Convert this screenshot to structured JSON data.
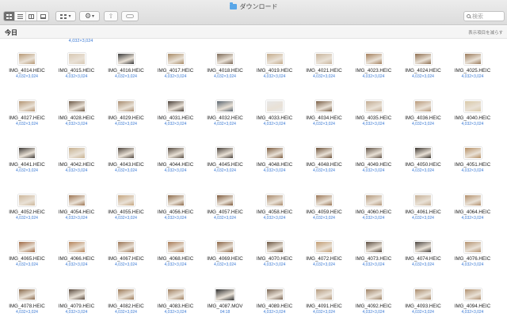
{
  "window": {
    "title": "ダウンロード"
  },
  "toolbar": {
    "search_placeholder": "検索"
  },
  "section": {
    "title": "今日",
    "show_less": "表示項目を減らす"
  },
  "top_partial_meta": "4,032×3,024",
  "rows": [
    [
      {
        "name": "IMG_4014.HEIC",
        "meta": "4,032×3,024",
        "tone": "#b89a76"
      },
      {
        "name": "IMG_4015.HEIC",
        "meta": "4,032×3,024",
        "tone": "#d8c9b4"
      },
      {
        "name": "IMG_4016.HEIC",
        "meta": "4,032×3,024",
        "tone": "#3a3a3a"
      },
      {
        "name": "IMG_4017.HEIC",
        "meta": "4,032×3,024",
        "tone": "#a88a66"
      },
      {
        "name": "IMG_4018.HEIC",
        "meta": "4,032×3,024",
        "tone": "#7d6a58"
      },
      {
        "name": "IMG_4019.HEIC",
        "meta": "4,032×3,024",
        "tone": "#c4ab8c"
      },
      {
        "name": "IMG_4021.HEIC",
        "meta": "4,032×3,024",
        "tone": "#c9b59d"
      },
      {
        "name": "IMG_4023.HEIC",
        "meta": "4,032×3,024",
        "tone": "#a47f5c"
      },
      {
        "name": "IMG_4024.HEIC",
        "meta": "4,032×3,024",
        "tone": "#8e6e4f"
      },
      {
        "name": "IMG_4025.HEIC",
        "meta": "4,032×3,024",
        "tone": "#9a7a5a"
      }
    ],
    [
      {
        "name": "IMG_4027.HEIC",
        "meta": "4,032×3,024",
        "tone": "#b49574"
      },
      {
        "name": "IMG_4028.HEIC",
        "meta": "4,032×3,024",
        "tone": "#6e5a48"
      },
      {
        "name": "IMG_4029.HEIC",
        "meta": "4,032×3,024",
        "tone": "#a88c70"
      },
      {
        "name": "IMG_4031.HEIC",
        "meta": "4,032×3,024",
        "tone": "#4a4038"
      },
      {
        "name": "IMG_4032.HEIC",
        "meta": "4,032×3,024",
        "tone": "#5b6670"
      },
      {
        "name": "IMG_4033.HEIC",
        "meta": "4,032×3,024",
        "tone": "#e6e6e6"
      },
      {
        "name": "IMG_4034.HEIC",
        "meta": "4,032×3,024",
        "tone": "#7a6048"
      },
      {
        "name": "IMG_4035.HEIC",
        "meta": "4,032×3,024",
        "tone": "#c2ab92"
      },
      {
        "name": "IMG_4036.HEIC",
        "meta": "4,032×3,024",
        "tone": "#b8997a"
      },
      {
        "name": "IMG_4040.HEIC",
        "meta": "4,032×3,024",
        "tone": "#d9c9a8"
      }
    ],
    [
      {
        "name": "IMG_4041.HEIC",
        "meta": "4,032×3,024",
        "tone": "#3e3a36"
      },
      {
        "name": "IMG_4042.HEIC",
        "meta": "4,032×3,024",
        "tone": "#c7b190"
      },
      {
        "name": "IMG_4043.HEIC",
        "meta": "4,032×3,024",
        "tone": "#4f463e"
      },
      {
        "name": "IMG_4044.HEIC",
        "meta": "4,032×3,024",
        "tone": "#554a40"
      },
      {
        "name": "IMG_4045.HEIC",
        "meta": "4,032×3,024",
        "tone": "#48403a"
      },
      {
        "name": "IMG_4048.HEIC",
        "meta": "4,032×3,024",
        "tone": "#7a5a3e"
      },
      {
        "name": "IMG_4048.HEIC",
        "meta": "4,032×3,024",
        "tone": "#6b5038"
      },
      {
        "name": "IMG_4049.HEIC",
        "meta": "4,032×3,024",
        "tone": "#5e5044"
      },
      {
        "name": "IMG_4050.HEIC",
        "meta": "4,032×3,024",
        "tone": "#3a342e"
      },
      {
        "name": "IMG_4051.HEIC",
        "meta": "4,032×3,024",
        "tone": "#b48d62"
      }
    ],
    [
      {
        "name": "IMG_4052.HEIC",
        "meta": "4,032×3,024",
        "tone": "#cdb79b"
      },
      {
        "name": "IMG_4054.HEIC",
        "meta": "4,032×3,024",
        "tone": "#9c7452"
      },
      {
        "name": "IMG_4055.HEIC",
        "meta": "4,032×3,024",
        "tone": "#c4a47e"
      },
      {
        "name": "IMG_4056.HEIC",
        "meta": "4,032×3,024",
        "tone": "#8c6a4a"
      },
      {
        "name": "IMG_4057.HEIC",
        "meta": "4,032×3,024",
        "tone": "#7e5a3c"
      },
      {
        "name": "IMG_4058.HEIC",
        "meta": "4,032×3,024",
        "tone": "#a8886a"
      },
      {
        "name": "IMG_4059.HEIC",
        "meta": "4,032×3,024",
        "tone": "#9a7656"
      },
      {
        "name": "IMG_4060.HEIC",
        "meta": "4,032×3,024",
        "tone": "#b3977a"
      },
      {
        "name": "IMG_4061.HEIC",
        "meta": "4,032×3,024",
        "tone": "#c6b096"
      },
      {
        "name": "IMG_4064.HEIC",
        "meta": "4,032×3,024",
        "tone": "#b28e6a"
      }
    ],
    [
      {
        "name": "IMG_4065.HEIC",
        "meta": "4,032×3,024",
        "tone": "#a06a44"
      },
      {
        "name": "IMG_4066.HEIC",
        "meta": "4,032×3,024",
        "tone": "#b5845a"
      },
      {
        "name": "IMG_4067.HEIC",
        "meta": "4,032×3,024",
        "tone": "#9a7454"
      },
      {
        "name": "IMG_4068.HEIC",
        "meta": "4,032×3,024",
        "tone": "#a87a54"
      },
      {
        "name": "IMG_4069.HEIC",
        "meta": "4,032×3,024",
        "tone": "#8a6444"
      },
      {
        "name": "IMG_4070.HEIC",
        "meta": "4,032×3,024",
        "tone": "#6a5440"
      },
      {
        "name": "IMG_4072.HEIC",
        "meta": "4,032×3,024",
        "tone": "#c29c72"
      },
      {
        "name": "IMG_4073.HEIC",
        "meta": "4,032×3,024",
        "tone": "#5a4c40"
      },
      {
        "name": "IMG_4074.HEIC",
        "meta": "4,032×3,024",
        "tone": "#4a4440"
      },
      {
        "name": "IMG_4076.HEIC",
        "meta": "4,032×3,024",
        "tone": "#b49270"
      }
    ],
    [
      {
        "name": "IMG_4078.HEIC",
        "meta": "4,032×3,024",
        "tone": "#8a6a4c"
      },
      {
        "name": "IMG_4079.HEIC",
        "meta": "4,032×3,024",
        "tone": "#5a4a3e"
      },
      {
        "name": "IMG_4082.HEIC",
        "meta": "4,032×3,024",
        "tone": "#9c7a58"
      },
      {
        "name": "IMG_4083.HEIC",
        "meta": "4,032×3,024",
        "tone": "#a08060"
      },
      {
        "name": "IMG_4087.MOV",
        "meta": "04:18",
        "tone": "#2e2e2e",
        "mov": true
      },
      {
        "name": "IMG_4089.HEIC",
        "meta": "4,032×3,024",
        "tone": "#7a6654"
      },
      {
        "name": "IMG_4091.HEIC",
        "meta": "4,032×3,024",
        "tone": "#b49a7e"
      },
      {
        "name": "IMG_4092.HEIC",
        "meta": "4,032×3,024",
        "tone": "#9e8266"
      },
      {
        "name": "IMG_4093.HEIC",
        "meta": "4,032×3,024",
        "tone": "#a88a6c"
      },
      {
        "name": "IMG_4094.HEIC",
        "meta": "4,032×3,024",
        "tone": "#b09070"
      }
    ]
  ]
}
